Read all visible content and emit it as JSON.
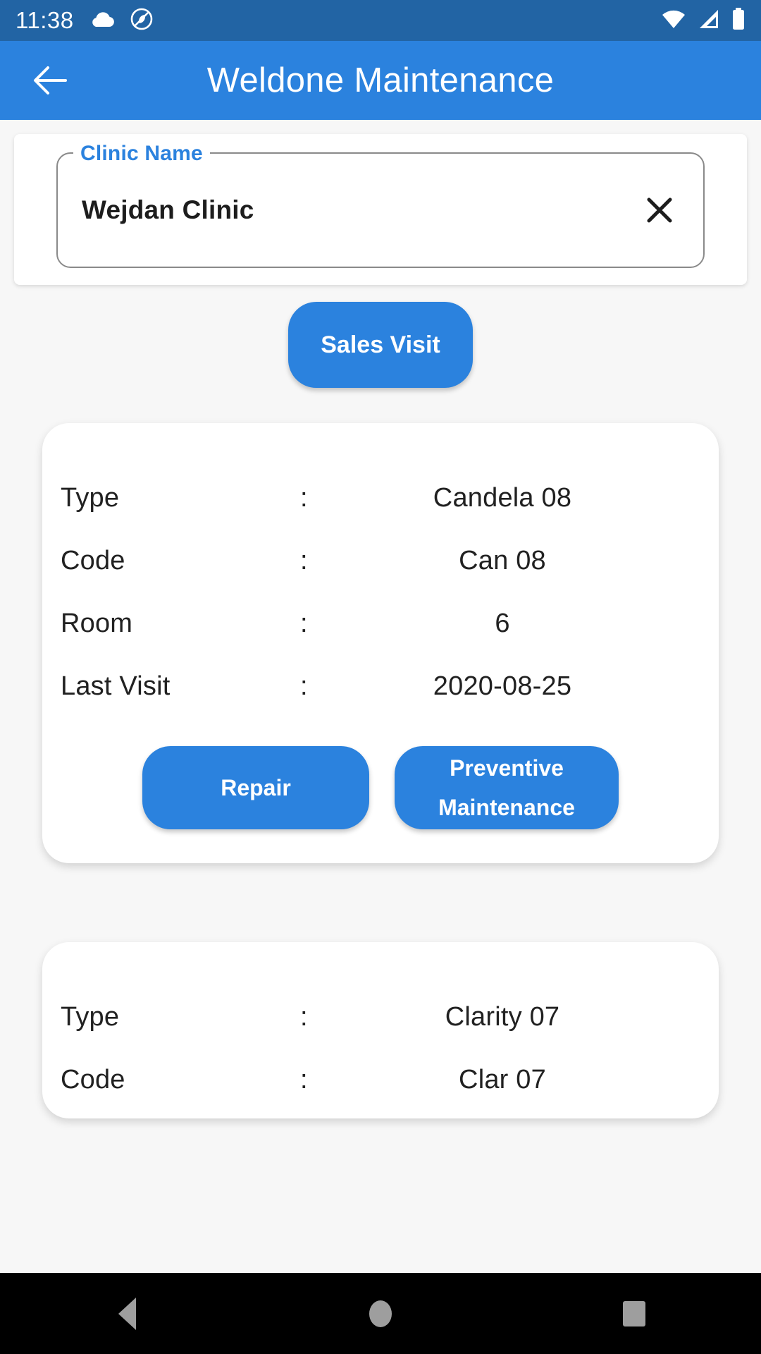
{
  "status_bar": {
    "time": "11:38",
    "left_icons": [
      "cloud-icon",
      "app-badge-icon"
    ],
    "right_icons": [
      "wifi-icon",
      "cellular-signal-icon",
      "battery-icon"
    ],
    "background_color": "#2264a4"
  },
  "app_bar": {
    "title": "Weldone Maintenance",
    "back_icon": "back-arrow-icon",
    "background_color": "#2b82de"
  },
  "clinic_field": {
    "label": "Clinic Name",
    "value": "Wejdan Clinic",
    "placeholder": "Clinic Name",
    "clear_icon": "close-icon",
    "label_color": "#2b82de"
  },
  "sales_visit_button": {
    "label": "Sales Visit",
    "color": "#2b82de"
  },
  "cards": [
    {
      "rows": [
        {
          "label": "Type",
          "separator": ":",
          "value": "Candela  08"
        },
        {
          "label": "Code",
          "separator": ":",
          "value": "Can 08"
        },
        {
          "label": "Room",
          "separator": ":",
          "value": "6"
        },
        {
          "label": "Last Visit",
          "separator": ":",
          "value": "2020-08-25"
        }
      ],
      "actions": {
        "repair": "Repair",
        "preventive_line1": "Preventive",
        "preventive_line2": "Maintenance"
      }
    },
    {
      "rows": [
        {
          "label": "Type",
          "separator": ":",
          "value": "Clarity 07"
        },
        {
          "label": "Code",
          "separator": ":",
          "value": "Clar 07"
        }
      ]
    }
  ],
  "nav_bar": {
    "back": "back-triangle-icon",
    "home": "home-circle-icon",
    "recents": "recents-square-icon"
  }
}
